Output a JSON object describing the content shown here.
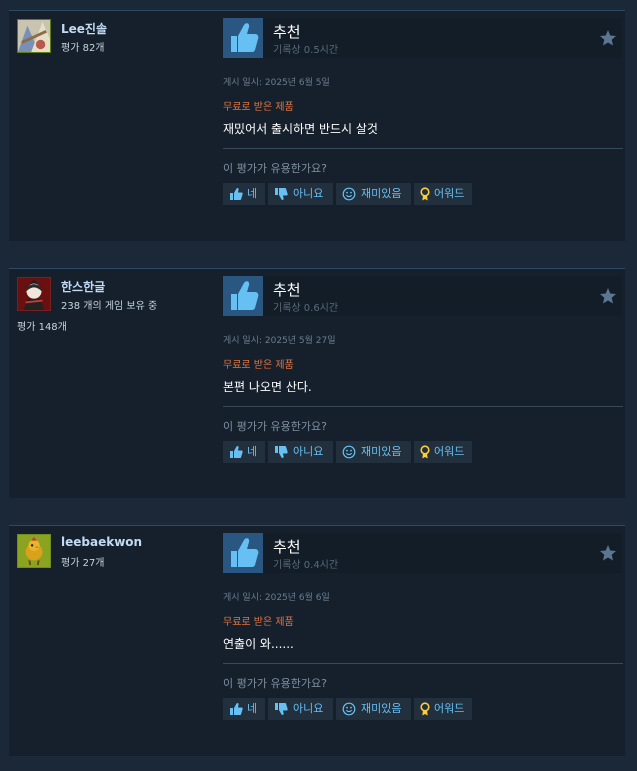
{
  "colors": {
    "background": "#1b2838",
    "card": "#16202d",
    "link_blue": "#66c0f4",
    "free_orange": "#e0743e",
    "thumb_bg": "#2a5781"
  },
  "vote_labels": {
    "yes": "네",
    "no": "아니요",
    "funny": "재미있음",
    "award": "어워드"
  },
  "reviews": [
    {
      "author": {
        "name": "Lee진솔",
        "line2": "평가 82개",
        "line3": ""
      },
      "recommendation": "추천",
      "hours": "기록상 0.5시간",
      "posted": "게시 일시: 2025년 6월 5일",
      "free_label": "무료로 받은 제품",
      "body": "재밌어서 출시하면 반드시 살것",
      "helpful_question": "이 평가가 유용한가요?"
    },
    {
      "author": {
        "name": "한스한글",
        "line2": "238 개의 게임 보유 중",
        "line3": "평가 148개"
      },
      "recommendation": "추천",
      "hours": "기록상 0.6시간",
      "posted": "게시 일시: 2025년 5월 27일",
      "free_label": "무료로 받은 제품",
      "body": "본편 나오면 산다.",
      "helpful_question": "이 평가가 유용한가요?"
    },
    {
      "author": {
        "name": "leebaekwon",
        "line2": "평가 27개",
        "line3": ""
      },
      "recommendation": "추천",
      "hours": "기록상 0.4시간",
      "posted": "게시 일시: 2025년 6월 6일",
      "free_label": "무료로 받은 제품",
      "body": "연출이 와......",
      "helpful_question": "이 평가가 유용한가요?"
    }
  ]
}
